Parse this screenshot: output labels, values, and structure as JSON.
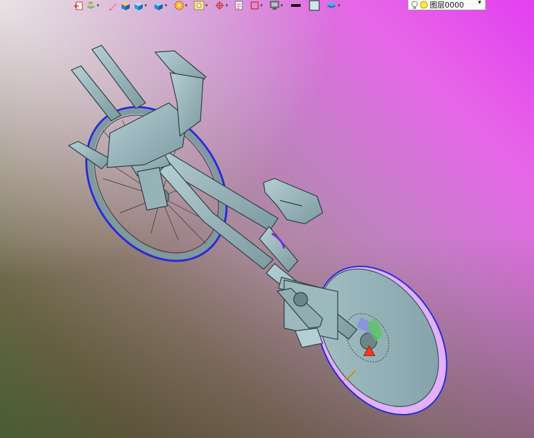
{
  "toolbar": {
    "buttons": [
      {
        "icon": "exit-icon",
        "has_dropdown": false
      },
      {
        "icon": "layers-stack-icon",
        "has_dropdown": true
      },
      {
        "icon": "pencil-icon",
        "has_dropdown": false
      },
      {
        "icon": "shaded-cube-icon",
        "has_dropdown": false
      },
      {
        "icon": "cube-view-icon",
        "has_dropdown": true
      },
      {
        "icon": "solid-block-icon",
        "has_dropdown": true
      },
      {
        "icon": "color-wheel-icon",
        "has_dropdown": true
      },
      {
        "icon": "snap-frame-icon",
        "has_dropdown": true
      },
      {
        "icon": "crosshair-target-icon",
        "has_dropdown": true
      },
      {
        "icon": "document-icon",
        "has_dropdown": false
      },
      {
        "icon": "frame-box-icon",
        "has_dropdown": true
      },
      {
        "icon": "monitor-icon",
        "has_dropdown": true
      },
      {
        "icon": "line-weight-icon",
        "has_dropdown": false
      },
      {
        "icon": "color-swatch-icon",
        "has_dropdown": false
      },
      {
        "icon": "layer-cubes-icon",
        "has_dropdown": true
      }
    ],
    "layer_select": {
      "value": "图层0000"
    }
  },
  "colors": {
    "accent_red": "#ff3a1a",
    "model_fill": "#87a6ad",
    "edge_blue": "#2a2ad8",
    "edge_magenta": "#d060f0"
  }
}
